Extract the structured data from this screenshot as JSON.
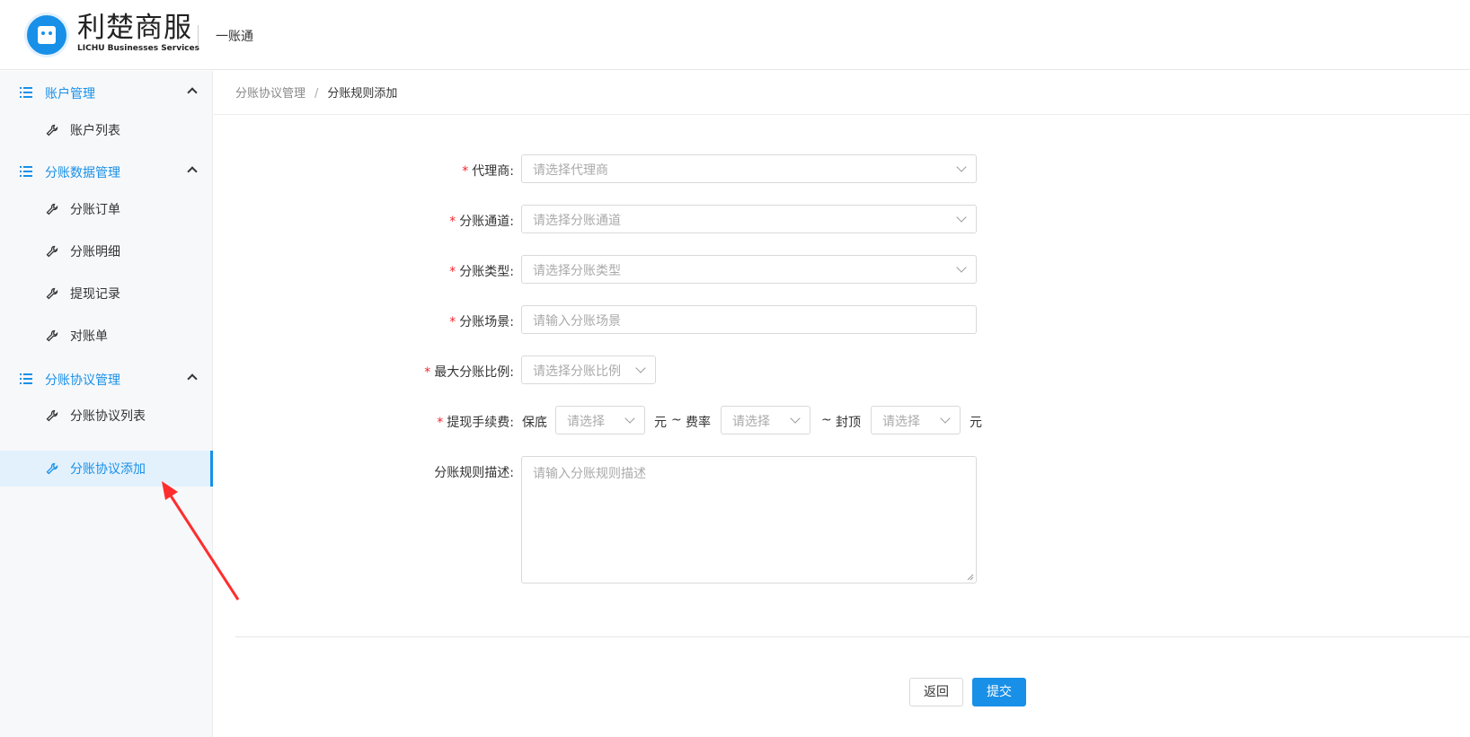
{
  "header": {
    "logo_cn": "利楚商服",
    "logo_en": "LICHU Businesses Services",
    "subtitle": "一账通"
  },
  "sidebar": {
    "groups": [
      {
        "label": "账户管理",
        "items": [
          {
            "label": "账户列表"
          }
        ]
      },
      {
        "label": "分账数据管理",
        "items": [
          {
            "label": "分账订单"
          },
          {
            "label": "分账明细"
          },
          {
            "label": "提现记录"
          },
          {
            "label": "对账单"
          }
        ]
      },
      {
        "label": "分账协议管理",
        "items": [
          {
            "label": "分账协议列表"
          },
          {
            "label": "分账协议添加",
            "active": true
          }
        ]
      }
    ]
  },
  "breadcrumb": {
    "parent": "分账协议管理",
    "separator": "/",
    "current": "分账规则添加"
  },
  "form": {
    "agent": {
      "label": "代理商",
      "placeholder": "请选择代理商"
    },
    "channel": {
      "label": "分账通道",
      "placeholder": "请选择分账通道"
    },
    "type": {
      "label": "分账类型",
      "placeholder": "请选择分账类型"
    },
    "scene": {
      "label": "分账场景",
      "placeholder": "请输入分账场景"
    },
    "max_ratio": {
      "label": "最大分账比例",
      "placeholder": "请选择分账比例"
    },
    "fee": {
      "label": "提现手续费",
      "min_label": "保底",
      "min_placeholder": "请选择",
      "unit_yuan": "元",
      "tilde": "~",
      "rate_label": "费率",
      "rate_placeholder": "请选择",
      "cap_label": "封顶",
      "cap_placeholder": "请选择",
      "unit_yuan_end": "元"
    },
    "desc": {
      "label": "分账规则描述",
      "placeholder": "请输入分账规则描述"
    },
    "colon": ":",
    "required_mark": "*"
  },
  "buttons": {
    "back": "返回",
    "submit": "提交"
  },
  "colors": {
    "accent": "#1890e8",
    "required": "#f5222d",
    "arrow": "#ff2d2d"
  },
  "icons": {
    "group": "list-icon",
    "item": "wrench-icon",
    "toggle": "chevron-up-icon",
    "select": "chevron-down-icon"
  }
}
